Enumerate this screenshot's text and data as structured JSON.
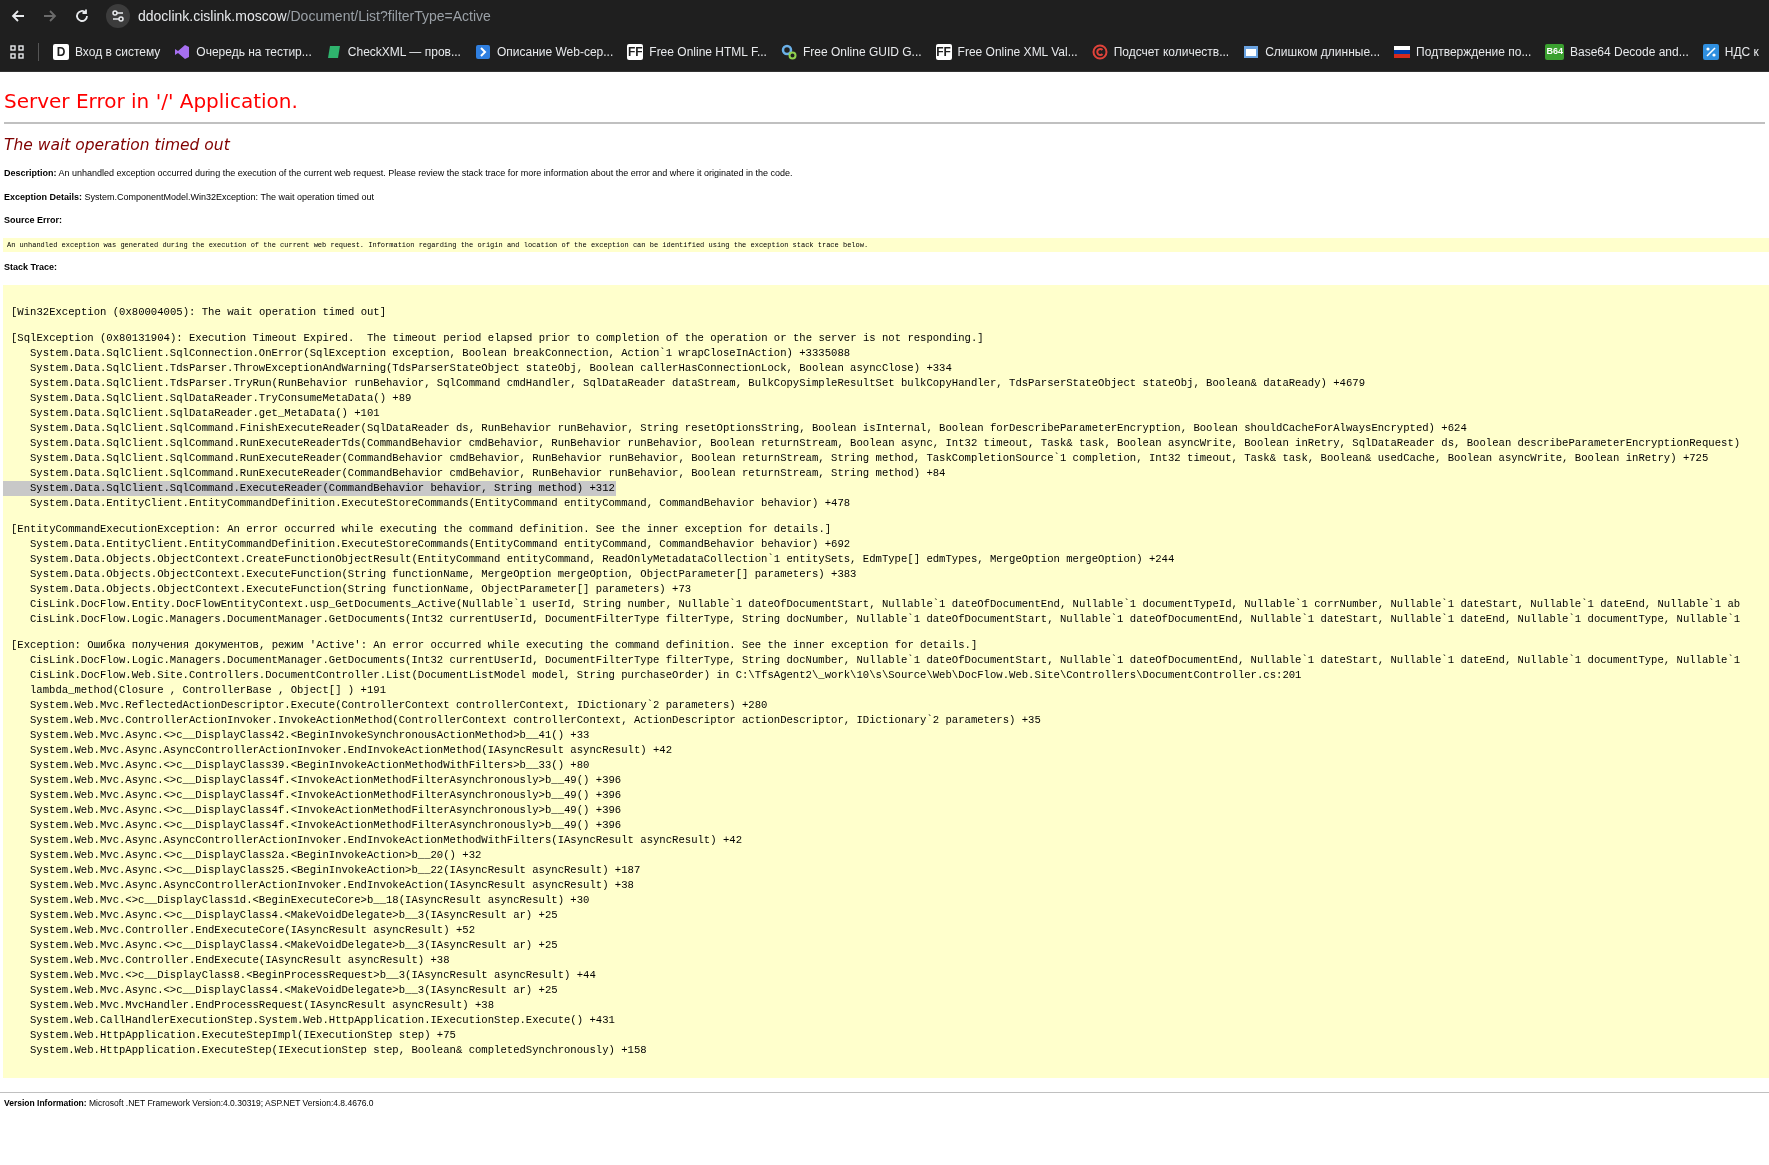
{
  "browser": {
    "url_host": "ddoclink.cislink.moscow",
    "url_path": "/Document/List?filterType=Active",
    "back_disabled": false,
    "forward_disabled": true,
    "bookmarks": [
      {
        "label": "Вход в систему",
        "kind": "letter",
        "icon_text": "D",
        "color": "#ffffff"
      },
      {
        "label": "Очередь на тестир...",
        "kind": "vs",
        "color": "#a66ff0"
      },
      {
        "label": "CheckXML — пров...",
        "kind": "sheet",
        "color": "#2fb36d"
      },
      {
        "label": "Описание Web-сер...",
        "kind": "arrow",
        "color": "#2f7fe0"
      },
      {
        "label": "Free Online HTML F...",
        "kind": "letter",
        "icon_text": "FF",
        "color": "#ffffff"
      },
      {
        "label": "Free Online GUID G...",
        "kind": "gears",
        "color": "#6ab0e8"
      },
      {
        "label": "Free Online XML Val...",
        "kind": "letter",
        "icon_text": "FF",
        "color": "#ffffff"
      },
      {
        "label": "Подсчет количеств...",
        "kind": "ring",
        "color": "#e0433a"
      },
      {
        "label": "Слишком длинные...",
        "kind": "window",
        "color": "#6aa2e0"
      },
      {
        "label": "Подтверждение по...",
        "kind": "flag",
        "color": "#d52b1e"
      },
      {
        "label": "Base64 Decode and...",
        "kind": "badge",
        "icon_text": "B64",
        "color": "#3aa02f"
      },
      {
        "label": "НДС к",
        "kind": "percent",
        "color": "#2f8fe0"
      }
    ]
  },
  "page": {
    "title": "Server Error in '/' Application.",
    "subtitle": "The wait operation timed out",
    "description_label": "Description:",
    "description": "An unhandled exception occurred during the execution of the current web request. Please review the stack trace for more information about the error and where it originated in the code.",
    "details_label": "Exception Details:",
    "details": "System.ComponentModel.Win32Exception: The wait operation timed out",
    "source_label": "Source Error:",
    "source_note": "An unhandled exception was generated during the execution of the current web request. Information regarding the origin and location of the exception can be identified using the exception stack trace below.",
    "stack_label": "Stack Trace:",
    "trace": [
      {
        "header": "[Win32Exception (0x80004005): The wait operation timed out]"
      },
      {
        "header": "[SqlException (0x80131904): Execution Timeout Expired.  The timeout period elapsed prior to completion of the operation or the server is not responding.]",
        "frames": [
          {
            "text": "System.Data.SqlClient.SqlConnection.OnError(SqlException exception, Boolean breakConnection, Action`1 wrapCloseInAction) +3335088",
            "selected": false
          },
          {
            "text": "System.Data.SqlClient.TdsParser.ThrowExceptionAndWarning(TdsParserStateObject stateObj, Boolean callerHasConnectionLock, Boolean asyncClose) +334",
            "selected": false
          },
          {
            "text": "System.Data.SqlClient.TdsParser.TryRun(RunBehavior runBehavior, SqlCommand cmdHandler, SqlDataReader dataStream, BulkCopySimpleResultSet bulkCopyHandler, TdsParserStateObject stateObj, Boolean& dataReady) +4679",
            "selected": false
          },
          {
            "text": "System.Data.SqlClient.SqlDataReader.TryConsumeMetaData() +89",
            "selected": false
          },
          {
            "text": "System.Data.SqlClient.SqlDataReader.get_MetaData() +101",
            "selected": false
          },
          {
            "text": "System.Data.SqlClient.SqlCommand.FinishExecuteReader(SqlDataReader ds, RunBehavior runBehavior, String resetOptionsString, Boolean isInternal, Boolean forDescribeParameterEncryption, Boolean shouldCacheForAlwaysEncrypted) +624",
            "selected": false
          },
          {
            "text": "System.Data.SqlClient.SqlCommand.RunExecuteReaderTds(CommandBehavior cmdBehavior, RunBehavior runBehavior, Boolean returnStream, Boolean async, Int32 timeout, Task& task, Boolean asyncWrite, Boolean inRetry, SqlDataReader ds, Boolean describeParameterEncryptionRequest)",
            "selected": false
          },
          {
            "text": "System.Data.SqlClient.SqlCommand.RunExecuteReader(CommandBehavior cmdBehavior, RunBehavior runBehavior, Boolean returnStream, String method, TaskCompletionSource`1 completion, Int32 timeout, Task& task, Boolean& usedCache, Boolean asyncWrite, Boolean inRetry) +725",
            "selected": false
          },
          {
            "text": "System.Data.SqlClient.SqlCommand.RunExecuteReader(CommandBehavior cmdBehavior, RunBehavior runBehavior, Boolean returnStream, String method) +84",
            "selected": false
          },
          {
            "text": "System.Data.SqlClient.SqlCommand.ExecuteReader(CommandBehavior behavior, String method) +312",
            "selected": true
          },
          {
            "text": "System.Data.EntityClient.EntityCommandDefinition.ExecuteStoreCommands(EntityCommand entityCommand, CommandBehavior behavior) +478",
            "selected": false
          }
        ]
      },
      {
        "header": "[EntityCommandExecutionException: An error occurred while executing the command definition. See the inner exception for details.]",
        "frames": [
          {
            "text": "System.Data.EntityClient.EntityCommandDefinition.ExecuteStoreCommands(EntityCommand entityCommand, CommandBehavior behavior) +692",
            "selected": false
          },
          {
            "text": "System.Data.Objects.ObjectContext.CreateFunctionObjectResult(EntityCommand entityCommand, ReadOnlyMetadataCollection`1 entitySets, EdmType[] edmTypes, MergeOption mergeOption) +244",
            "selected": false
          },
          {
            "text": "System.Data.Objects.ObjectContext.ExecuteFunction(String functionName, MergeOption mergeOption, ObjectParameter[] parameters) +383",
            "selected": false
          },
          {
            "text": "System.Data.Objects.ObjectContext.ExecuteFunction(String functionName, ObjectParameter[] parameters) +73",
            "selected": false
          },
          {
            "text": "CisLink.DocFlow.Entity.DocFlowEntityContext.usp_GetDocuments_Active(Nullable`1 userId, String number, Nullable`1 dateOfDocumentStart, Nullable`1 dateOfDocumentEnd, Nullable`1 documentTypeId, Nullable`1 corrNumber, Nullable`1 dateStart, Nullable`1 dateEnd, Nullable`1 ab",
            "selected": false
          },
          {
            "text": "CisLink.DocFlow.Logic.Managers.DocumentManager.GetDocuments(Int32 currentUserId, DocumentFilterType filterType, String docNumber, Nullable`1 dateOfDocumentStart, Nullable`1 dateOfDocumentEnd, Nullable`1 dateStart, Nullable`1 dateEnd, Nullable`1 documentType, Nullable`1",
            "selected": false
          }
        ]
      },
      {
        "header": "[Exception: Ошибка получения документов, режим 'Active': An error occurred while executing the command definition. See the inner exception for details.]",
        "frames": [
          {
            "text": "CisLink.DocFlow.Logic.Managers.DocumentManager.GetDocuments(Int32 currentUserId, DocumentFilterType filterType, String docNumber, Nullable`1 dateOfDocumentStart, Nullable`1 dateOfDocumentEnd, Nullable`1 dateStart, Nullable`1 dateEnd, Nullable`1 documentType, Nullable`1",
            "selected": false
          },
          {
            "text": "CisLink.DocFlow.Web.Site.Controllers.DocumentController.List(DocumentListModel model, String purchaseOrder) in C:\\TfsAgent2\\_work\\10\\s\\Source\\Web\\DocFlow.Web.Site\\Controllers\\DocumentController.cs:201",
            "selected": false
          },
          {
            "text": "lambda_method(Closure , ControllerBase , Object[] ) +191",
            "selected": false
          },
          {
            "text": "System.Web.Mvc.ReflectedActionDescriptor.Execute(ControllerContext controllerContext, IDictionary`2 parameters) +280",
            "selected": false
          },
          {
            "text": "System.Web.Mvc.ControllerActionInvoker.InvokeActionMethod(ControllerContext controllerContext, ActionDescriptor actionDescriptor, IDictionary`2 parameters) +35",
            "selected": false
          },
          {
            "text": "System.Web.Mvc.Async.<>c__DisplayClass42.<BeginInvokeSynchronousActionMethod>b__41() +33",
            "selected": false
          },
          {
            "text": "System.Web.Mvc.Async.AsyncControllerActionInvoker.EndInvokeActionMethod(IAsyncResult asyncResult) +42",
            "selected": false
          },
          {
            "text": "System.Web.Mvc.Async.<>c__DisplayClass39.<BeginInvokeActionMethodWithFilters>b__33() +80",
            "selected": false
          },
          {
            "text": "System.Web.Mvc.Async.<>c__DisplayClass4f.<InvokeActionMethodFilterAsynchronously>b__49() +396",
            "selected": false
          },
          {
            "text": "System.Web.Mvc.Async.<>c__DisplayClass4f.<InvokeActionMethodFilterAsynchronously>b__49() +396",
            "selected": false
          },
          {
            "text": "System.Web.Mvc.Async.<>c__DisplayClass4f.<InvokeActionMethodFilterAsynchronously>b__49() +396",
            "selected": false
          },
          {
            "text": "System.Web.Mvc.Async.<>c__DisplayClass4f.<InvokeActionMethodFilterAsynchronously>b__49() +396",
            "selected": false
          },
          {
            "text": "System.Web.Mvc.Async.AsyncControllerActionInvoker.EndInvokeActionMethodWithFilters(IAsyncResult asyncResult) +42",
            "selected": false
          },
          {
            "text": "System.Web.Mvc.Async.<>c__DisplayClass2a.<BeginInvokeAction>b__20() +32",
            "selected": false
          },
          {
            "text": "System.Web.Mvc.Async.<>c__DisplayClass25.<BeginInvokeAction>b__22(IAsyncResult asyncResult) +187",
            "selected": false
          },
          {
            "text": "System.Web.Mvc.Async.AsyncControllerActionInvoker.EndInvokeAction(IAsyncResult asyncResult) +38",
            "selected": false
          },
          {
            "text": "System.Web.Mvc.<>c__DisplayClass1d.<BeginExecuteCore>b__18(IAsyncResult asyncResult) +30",
            "selected": false
          },
          {
            "text": "System.Web.Mvc.Async.<>c__DisplayClass4.<MakeVoidDelegate>b__3(IAsyncResult ar) +25",
            "selected": false
          },
          {
            "text": "System.Web.Mvc.Controller.EndExecuteCore(IAsyncResult asyncResult) +52",
            "selected": false
          },
          {
            "text": "System.Web.Mvc.Async.<>c__DisplayClass4.<MakeVoidDelegate>b__3(IAsyncResult ar) +25",
            "selected": false
          },
          {
            "text": "System.Web.Mvc.Controller.EndExecute(IAsyncResult asyncResult) +38",
            "selected": false
          },
          {
            "text": "System.Web.Mvc.<>c__DisplayClass8.<BeginProcessRequest>b__3(IAsyncResult asyncResult) +44",
            "selected": false
          },
          {
            "text": "System.Web.Mvc.Async.<>c__DisplayClass4.<MakeVoidDelegate>b__3(IAsyncResult ar) +25",
            "selected": false
          },
          {
            "text": "System.Web.Mvc.MvcHandler.EndProcessRequest(IAsyncResult asyncResult) +38",
            "selected": false
          },
          {
            "text": "System.Web.CallHandlerExecutionStep.System.Web.HttpApplication.IExecutionStep.Execute() +431",
            "selected": false
          },
          {
            "text": "System.Web.HttpApplication.ExecuteStepImpl(IExecutionStep step) +75",
            "selected": false
          },
          {
            "text": "System.Web.HttpApplication.ExecuteStep(IExecutionStep step, Boolean& completedSynchronously) +158",
            "selected": false
          }
        ]
      }
    ],
    "version_label": "Version Information:",
    "version": "Microsoft .NET Framework Version:4.0.30319; ASP.NET Version:4.8.4676.0"
  }
}
